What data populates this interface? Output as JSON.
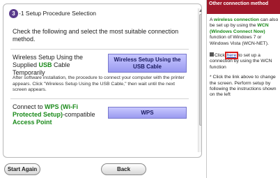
{
  "step": {
    "number": "3",
    "title": "-1 Setup Procedure Selection"
  },
  "instructions": "Check the following and select the most suitable connection method.",
  "usb_option": {
    "label_line1": "Wireless Setup Using the",
    "label_line2a": "Supplied ",
    "label_usb": "USB",
    "label_line2b": " Cable",
    "label_line3": "Temporarily",
    "button_label": "Wireless Setup Using the USB Cable",
    "description": "After software installation, the procedure to connect your computer with the printer appears. Click \"Wireless Setup Using the USB Cable,\" then wait until the next screen appears."
  },
  "wps_option": {
    "label_prefix": "Connect to ",
    "label_wps": "WPS (Wi-Fi Protected Setup)",
    "label_mid": "-compatible",
    "label_ap": "Access Point",
    "button_label": "WPS"
  },
  "buttons": {
    "start_again": "Start Again",
    "back": "Back"
  },
  "side_panel": {
    "header": "Other connection method",
    "text_prefix": "A ",
    "wireless_connection": "wireless connection",
    "text_mid1": " can also be set up by using the ",
    "wcn": "WCN (Windows Connect Now)",
    "text_mid2": " function of Windows 7 or Windows Vista (WCN-NET).",
    "link_prefix": "Click ",
    "link_text": "here",
    "link_suffix": " to set up a connection by using the WCN function",
    "note": "* Click the link above to change the screen. Perform setup by following the instructions shown on the left"
  },
  "colors": {
    "accent_green": "#1a8a1a",
    "side_header_red": "#a0182a",
    "step_purple": "#5a3b8c",
    "button_blue": "#9a9af0",
    "highlight_red": "#d81f1f"
  }
}
